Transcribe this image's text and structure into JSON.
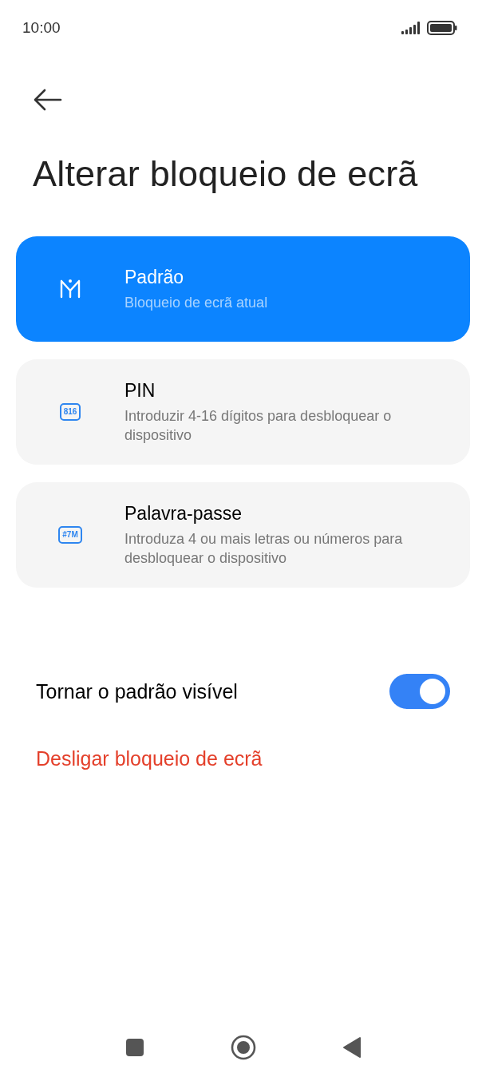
{
  "status_bar": {
    "time": "10:00"
  },
  "title": "Alterar bloqueio de ecrã",
  "options": [
    {
      "kind": "pattern",
      "title": "Padrão",
      "subtitle": "Bloqueio de ecrã atual",
      "selected": true
    },
    {
      "kind": "pin",
      "icon_text": "816",
      "title": "PIN",
      "subtitle": "Introduzir 4-16 dígitos para desbloquear o dispositivo",
      "selected": false
    },
    {
      "kind": "password",
      "icon_text": "#7M",
      "title": "Palavra-passe",
      "subtitle": "Introduza 4 ou mais letras ou números para desbloquear o dispositivo",
      "selected": false
    }
  ],
  "toggle": {
    "label": "Tornar o padrão visível",
    "on": true
  },
  "danger_link": "Desligar bloqueio de ecrã"
}
